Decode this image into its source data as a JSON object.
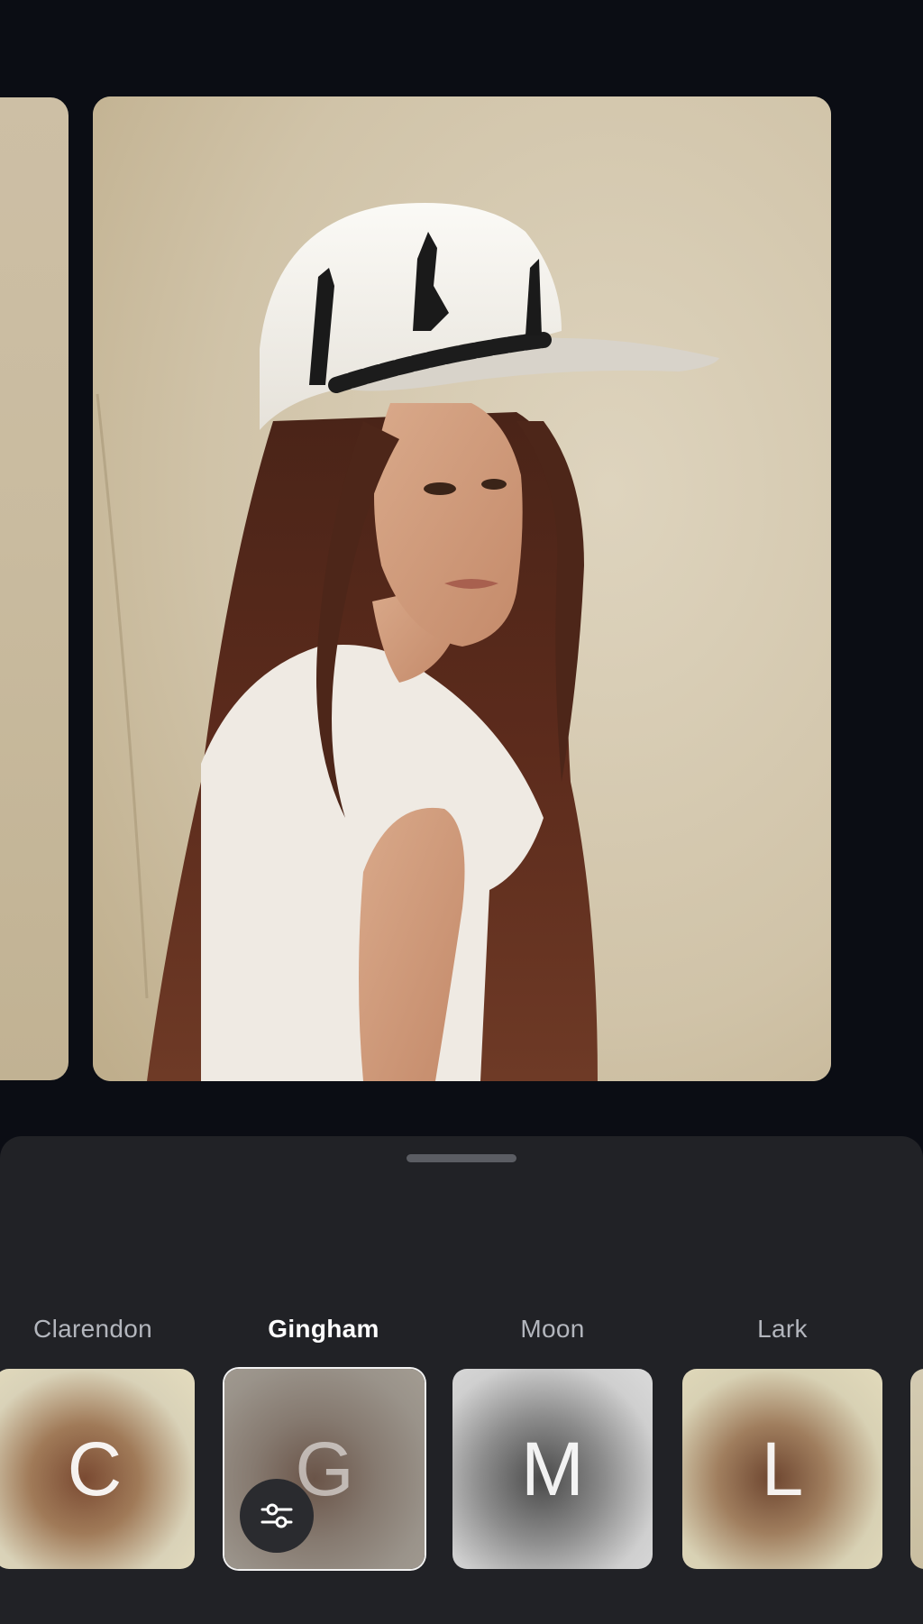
{
  "editor": {
    "mode": "photo-filter-editor"
  },
  "filters": {
    "items": [
      {
        "label": "Clarendon",
        "letter": "C",
        "selected": false
      },
      {
        "label": "Gingham",
        "letter": "G",
        "selected": true
      },
      {
        "label": "Moon",
        "letter": "M",
        "selected": false
      },
      {
        "label": "Lark",
        "letter": "L",
        "selected": false
      }
    ]
  },
  "icons": {
    "adjust": "sliders-icon",
    "grabber": "drag-handle"
  },
  "colors": {
    "background": "#0b0d14",
    "sheet": "#212226",
    "label_inactive": "#b3b6bd",
    "label_active": "#ffffff"
  }
}
